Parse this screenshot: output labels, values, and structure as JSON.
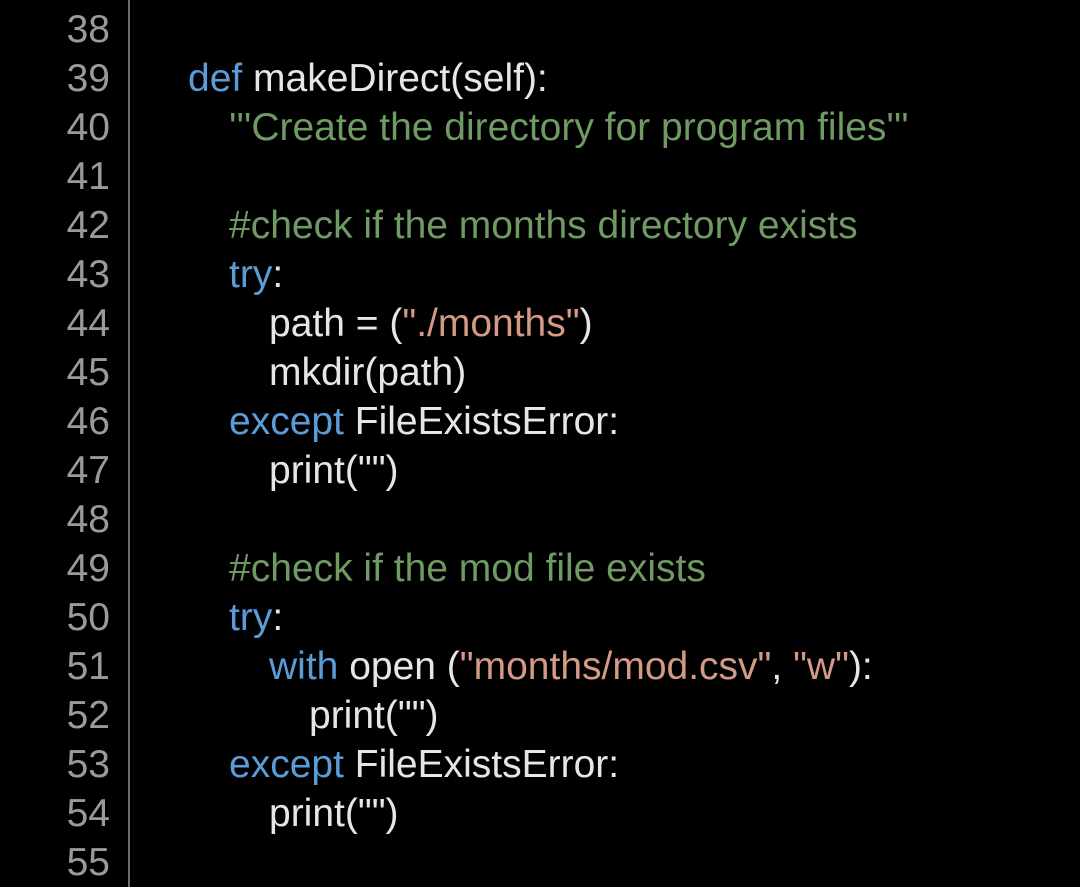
{
  "editor": {
    "lines": [
      {
        "number": "38",
        "tokens": []
      },
      {
        "number": "39",
        "tokens": [
          {
            "type": "kw",
            "text": "def"
          },
          {
            "type": "plain",
            "text": " makeDirect(self):"
          }
        ]
      },
      {
        "number": "40",
        "tokens": [
          {
            "type": "doc",
            "text": "'''Create the directory for program files'''"
          }
        ]
      },
      {
        "number": "41",
        "tokens": []
      },
      {
        "number": "42",
        "tokens": [
          {
            "type": "cmt",
            "text": "#check if the months directory exists"
          }
        ]
      },
      {
        "number": "43",
        "tokens": [
          {
            "type": "kw",
            "text": "try"
          },
          {
            "type": "plain",
            "text": ":"
          }
        ]
      },
      {
        "number": "44",
        "tokens": [
          {
            "type": "plain",
            "text": "path = ("
          },
          {
            "type": "str",
            "text": "\"./months\""
          },
          {
            "type": "plain",
            "text": ")"
          }
        ]
      },
      {
        "number": "45",
        "tokens": [
          {
            "type": "plain",
            "text": "mkdir(path)"
          }
        ]
      },
      {
        "number": "46",
        "tokens": [
          {
            "type": "kw",
            "text": "except"
          },
          {
            "type": "plain",
            "text": " FileExistsError:"
          }
        ]
      },
      {
        "number": "47",
        "tokens": [
          {
            "type": "plain",
            "text": "print(\"\")"
          }
        ]
      },
      {
        "number": "48",
        "tokens": []
      },
      {
        "number": "49",
        "tokens": [
          {
            "type": "cmt",
            "text": "#check if the mod file exists"
          }
        ]
      },
      {
        "number": "50",
        "tokens": [
          {
            "type": "kw",
            "text": "try"
          },
          {
            "type": "plain",
            "text": ":"
          }
        ]
      },
      {
        "number": "51",
        "tokens": [
          {
            "type": "kw",
            "text": "with"
          },
          {
            "type": "plain",
            "text": " open ("
          },
          {
            "type": "str",
            "text": "\"months/mod.csv\""
          },
          {
            "type": "plain",
            "text": ", "
          },
          {
            "type": "str",
            "text": "\"w\""
          },
          {
            "type": "plain",
            "text": "):"
          }
        ]
      },
      {
        "number": "52",
        "tokens": [
          {
            "type": "plain",
            "text": "print(\"\")"
          }
        ]
      },
      {
        "number": "53",
        "tokens": [
          {
            "type": "kw",
            "text": "except"
          },
          {
            "type": "plain",
            "text": " FileExistsError:"
          }
        ]
      },
      {
        "number": "54",
        "tokens": [
          {
            "type": "plain",
            "text": "print(\"\")"
          }
        ]
      },
      {
        "number": "55",
        "tokens": []
      }
    ]
  },
  "colors": {
    "background": "#000000",
    "line_number": "#9a9a9a",
    "keyword": "#5a9bd8",
    "string": "#d49a86",
    "comment": "#6f9a63",
    "plain": "#e6e6e6"
  }
}
